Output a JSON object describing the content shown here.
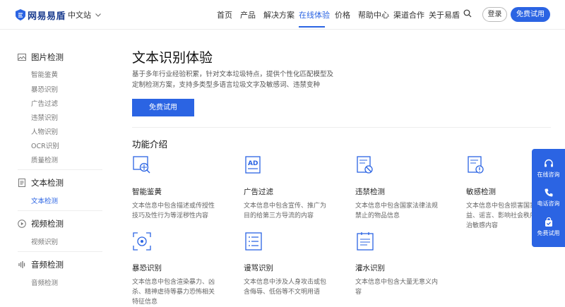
{
  "nav": {
    "logo_text": "网易易盾",
    "region": "中文站",
    "menu": [
      "首页",
      "产品",
      "解决方案",
      "在线体验",
      "价格",
      "帮助中心",
      "渠道合作",
      "关于易盾"
    ],
    "active_menu": "在线体验",
    "login": "登录",
    "trial": "免费试用"
  },
  "sidebar": {
    "groups": [
      {
        "label": "图片检测",
        "icon": "image-icon",
        "items": [
          "智能鉴黄",
          "暴恐识别",
          "广告过滤",
          "违禁识别",
          "人物识别",
          "OCR识别",
          "质量检测"
        ]
      },
      {
        "label": "文本检测",
        "icon": "document-icon",
        "items": [
          "文本检测"
        ],
        "active_item": "文本检测"
      },
      {
        "label": "视频检测",
        "icon": "play-icon",
        "items": [
          "视频识别"
        ]
      },
      {
        "label": "音频检测",
        "icon": "audio-icon",
        "items": [
          "音频检测"
        ]
      }
    ]
  },
  "main": {
    "title": "文本识别体验",
    "desc": "基于多年行业经验积累，针对文本垃圾特点，提供个性化匹配模型及定制检测方案，支持多类型多语言垃圾文字及敏感词、违禁变种",
    "trial_button": "免费试用",
    "section_title": "功能介绍",
    "features": [
      {
        "title": "智能鉴黄",
        "desc": "文本信息中包含描述或传授性技巧及性行为等淫秽性内容",
        "icon": "magnifier-picture-icon"
      },
      {
        "title": "广告过滤",
        "desc": "文本信息中包含宣传、推广为目的给第三方导流的内容",
        "icon": "ad-icon"
      },
      {
        "title": "违禁检测",
        "desc": "文本信息中包含国家法律法规禁止的物品信息",
        "icon": "forbidden-document-icon"
      },
      {
        "title": "敏感检测",
        "desc": "文本信息中包含损害国家利益、谣言、影响社会秩序及政治敏感内容",
        "icon": "sensitive-document-icon"
      },
      {
        "title": "暴恐识别",
        "desc": "文本信息中包含渲染暴力、凶杀、精神虐待等暴力恐怖相关特征信息",
        "icon": "terror-scan-icon"
      },
      {
        "title": "谩骂识别",
        "desc": "文本信息中涉及人身攻击或包含侮辱、低俗等不文明用语",
        "icon": "abuse-list-icon"
      },
      {
        "title": "灌水识别",
        "desc": "文本信息中包含大量无意义内容",
        "icon": "spam-document-icon"
      }
    ]
  },
  "float": {
    "items": [
      {
        "label": "在线咨询",
        "icon": "headset-icon"
      },
      {
        "label": "电话咨询",
        "icon": "phone-icon"
      },
      {
        "label": "免费试用",
        "icon": "trial-bag-icon"
      }
    ]
  },
  "colors": {
    "accent": "#2b64e3",
    "brand": "#1a3c8f"
  }
}
